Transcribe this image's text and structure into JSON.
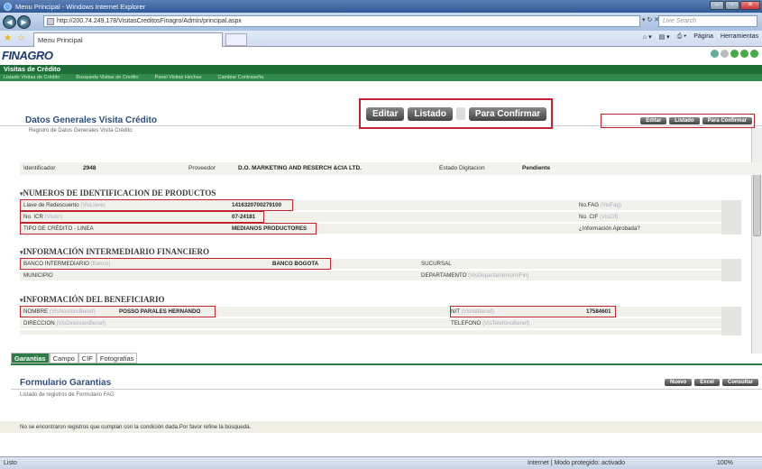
{
  "window": {
    "title": "Menu Principal - Windows Internet Explorer"
  },
  "browser": {
    "url": "http://200.74.249.178/VisitasCreditosFinagro/Admin/principal.aspx",
    "search_placeholder": "Live Search",
    "tab_title": "Menu Principal",
    "page_menu": "Página",
    "tools_menu": "Herramientas"
  },
  "app": {
    "logo": "FINAGRO",
    "section": "Visitas de Crédito",
    "menu": [
      "Listado Visitas de Crédito",
      "Busqueda Visitas de Credito",
      "Panel Visitas Hechas",
      "Cambiar Contraseña"
    ]
  },
  "actions": {
    "edit": "Editar",
    "list": "Listado",
    "confirm": "Para Confirmar"
  },
  "header": {
    "title": "Datos Generales Visita Crédito",
    "subtitle": "Registro de Datos Generales Visita Crédito"
  },
  "general": {
    "id_label": "Identificador",
    "id_value": "2948",
    "provider_label": "Proveedor",
    "provider_value": "D.O. MARKETING AND RESERCH &CIA LTD.",
    "state_label": "Estado Digitacion",
    "state_value": "Pendiente"
  },
  "products": {
    "heading": "NUMEROS DE IDENTIFICACION DE PRODUCTOS",
    "llave_label": "Llave de Redescuento",
    "llave_hint": "(VisLlave)",
    "llave_value": "1416320700279100",
    "icr_label": "No. ICR",
    "icr_hint": "(VisIcr)",
    "icr_value": "07-24181",
    "tipo_label": "TIPO DE CRÉDITO - LINEA",
    "tipo_value": "MEDIANOS PRODUCTORES",
    "fag_label": "No.FAG",
    "fag_hint": "(VisFag)",
    "cif_label": "No. CIF",
    "cif_hint": "(VisCif)",
    "aprob_label": "¿Información Aprobada?"
  },
  "intermediary": {
    "heading": "INFORMACIÓN INTERMEDIARIO FINANCIERO",
    "bank_label": "BANCO INTERMEDIARIO",
    "bank_hint": "(Banco)",
    "bank_value": "BANCO BOGOTA",
    "branch_label": "SUCURSAL",
    "municipio_label": "MUNICIPIO",
    "depto_label": "DEPARTAMENTO",
    "depto_hint": "(VisDepartamentoIntFin)"
  },
  "beneficiary": {
    "heading": "INFORMACIÓN DEL BENEFICIARIO",
    "name_label": "NOMBRE",
    "name_hint": "(VisNombreBenef)",
    "name_value": "POSSO PARALES HERNANDO",
    "nit_label": "NIT",
    "nit_hint": "(VisNitBenef)",
    "nit_value": "17584601",
    "addr_label": "DIRECCION",
    "addr_hint": "(VisDireccionBenef)",
    "phone_label": "TELEFONO",
    "phone_hint": "(VisTelefonoBenef)"
  },
  "tabs": [
    "Garantias",
    "Campo",
    "CIF",
    "Fotografias"
  ],
  "form": {
    "title": "Formulario Garantias",
    "subtitle": "Listado de registros de Formulario FAG",
    "new": "Nuevo",
    "excel": "Excel",
    "query": "Consultar",
    "empty_msg": "No se encontraron registros que cumplan con la condición dada.Por favor refine la búsqueda."
  },
  "status": {
    "left": "Listo",
    "zone": "Internet | Modo protegido: activado",
    "zoom": "100%"
  },
  "colors": {
    "accent_green": "#1f6e3a",
    "highlight_red": "#c0242f",
    "title_blue": "#2e4e7e"
  }
}
